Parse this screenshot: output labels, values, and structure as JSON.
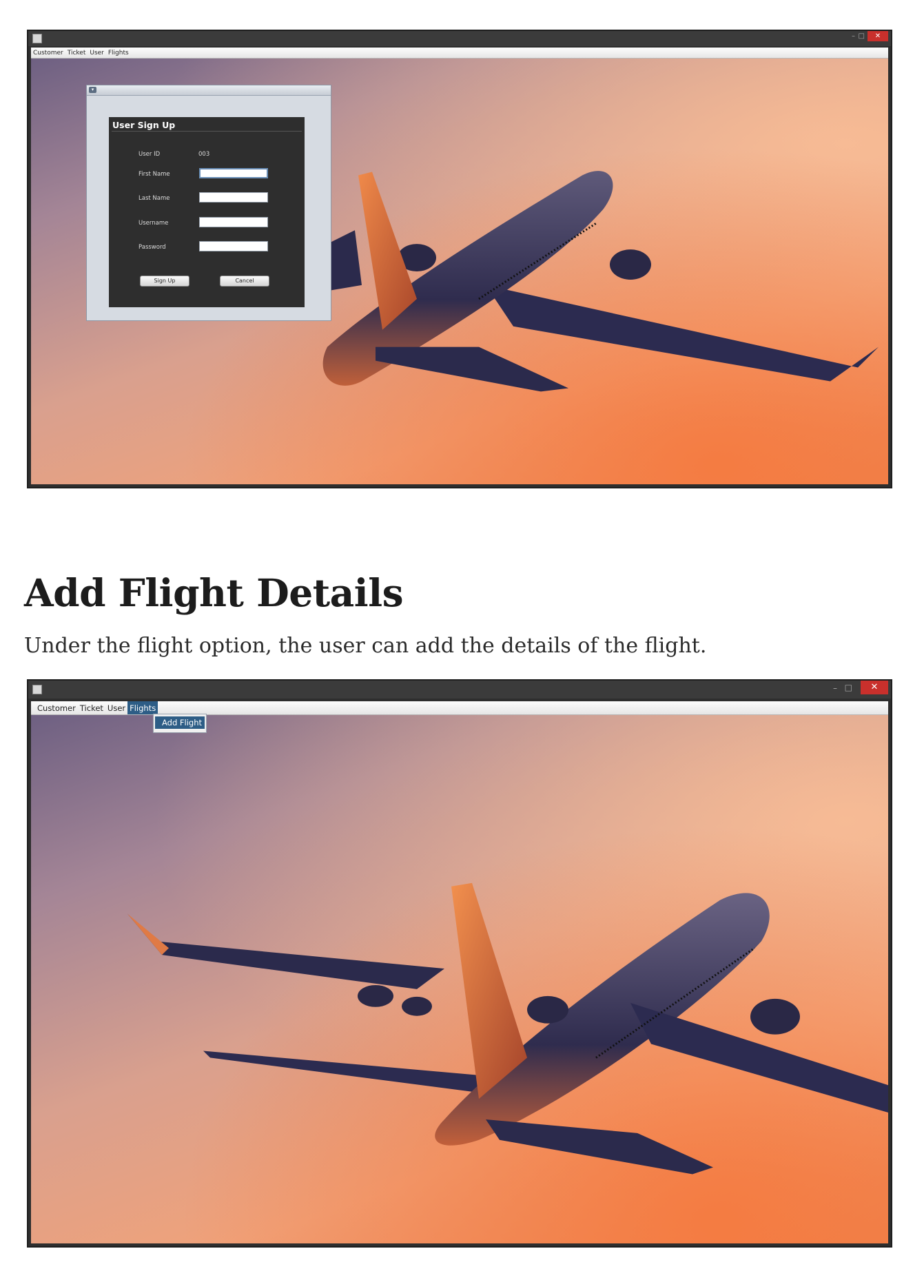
{
  "screenshot_top": {
    "window": {
      "minimize": "–",
      "maximize": "□",
      "close": "✕"
    },
    "menubar": [
      "Customer",
      "Ticket",
      "User",
      "Flights"
    ],
    "dialog": {
      "title": "User Sign Up",
      "fields": {
        "user_id_label": "User ID",
        "user_id_value": "003",
        "first_name_label": "First Name",
        "first_name_value": "",
        "last_name_label": "Last Name",
        "last_name_value": "",
        "username_label": "Username",
        "username_value": "",
        "password_label": "Password",
        "password_value": ""
      },
      "sign_up_button": "Sign Up",
      "cancel_button": "Cancel"
    }
  },
  "section": {
    "heading": "Add Flight Details",
    "paragraph": "Under the flight option, the user can add the details of the flight."
  },
  "screenshot_bottom": {
    "window": {
      "minimize": "–",
      "maximize": "□",
      "close": "✕"
    },
    "menubar": [
      "Customer",
      "Ticket",
      "User",
      "Flights"
    ],
    "active_menu": "Flights",
    "dropdown_items": [
      "Add Flight"
    ]
  },
  "colors": {
    "titlebar": "#3b3b3b",
    "close_button": "#c9302c",
    "menu_highlight": "#2d5d86",
    "form_panel": "#2e2e2e"
  },
  "icons": {
    "app": "java-app-icon",
    "dialog_menu": "chevron-down-icon"
  }
}
